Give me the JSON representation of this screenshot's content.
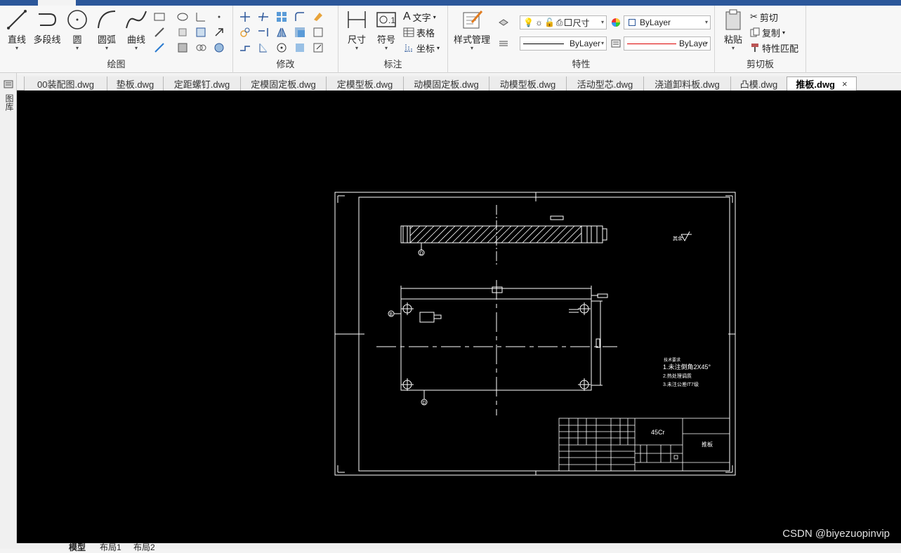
{
  "ribbon": {
    "draw": {
      "title": "绘图",
      "line": "直线",
      "polyline": "多段线",
      "circle": "圆",
      "arc": "圆弧",
      "curve": "曲线"
    },
    "modify": {
      "title": "修改"
    },
    "annotate": {
      "title": "标注",
      "dimension": "尺寸",
      "symbol": "符号",
      "text": "文字",
      "table": "表格",
      "coordinate": "坐标"
    },
    "properties": {
      "title": "特性",
      "style_manager": "样式管理",
      "layer_name": "尺寸",
      "color_value": "ByLayer",
      "linetype_value": "ByLayer",
      "lineweight_value": "ByLaye"
    },
    "clipboard": {
      "title": "剪切板",
      "paste": "粘贴",
      "cut": "剪切",
      "copy": "复制",
      "match": "特性匹配"
    }
  },
  "left_toolbar": {
    "label": "图库"
  },
  "doc_tabs": [
    "00装配图.dwg",
    "垫板.dwg",
    "定距螺钉.dwg",
    "定模固定板.dwg",
    "定模型板.dwg",
    "动模固定板.dwg",
    "动模型板.dwg",
    "活动型芯.dwg",
    "浇道卸料板.dwg",
    "凸模.dwg",
    "推板.dwg"
  ],
  "active_doc": "推板.dwg",
  "close_glyph": "×",
  "drawing": {
    "material": "45Cr",
    "part_name": "推板",
    "roughness_prefix": "其余",
    "notes_title": "技术要求",
    "note_1": "1.未注倒角2X45°",
    "note_2": "2.热处理调质",
    "note_3": "3.未注公差IT7级",
    "datum_d": "D",
    "datum_b": "B"
  },
  "layout_tabs": [
    "模型",
    "布局1",
    "布局2"
  ],
  "watermark": "CSDN @biyezuopinvip",
  "colors": {
    "accent": "#2b579a",
    "canvas": "#000000",
    "ink": "#ffffff"
  }
}
